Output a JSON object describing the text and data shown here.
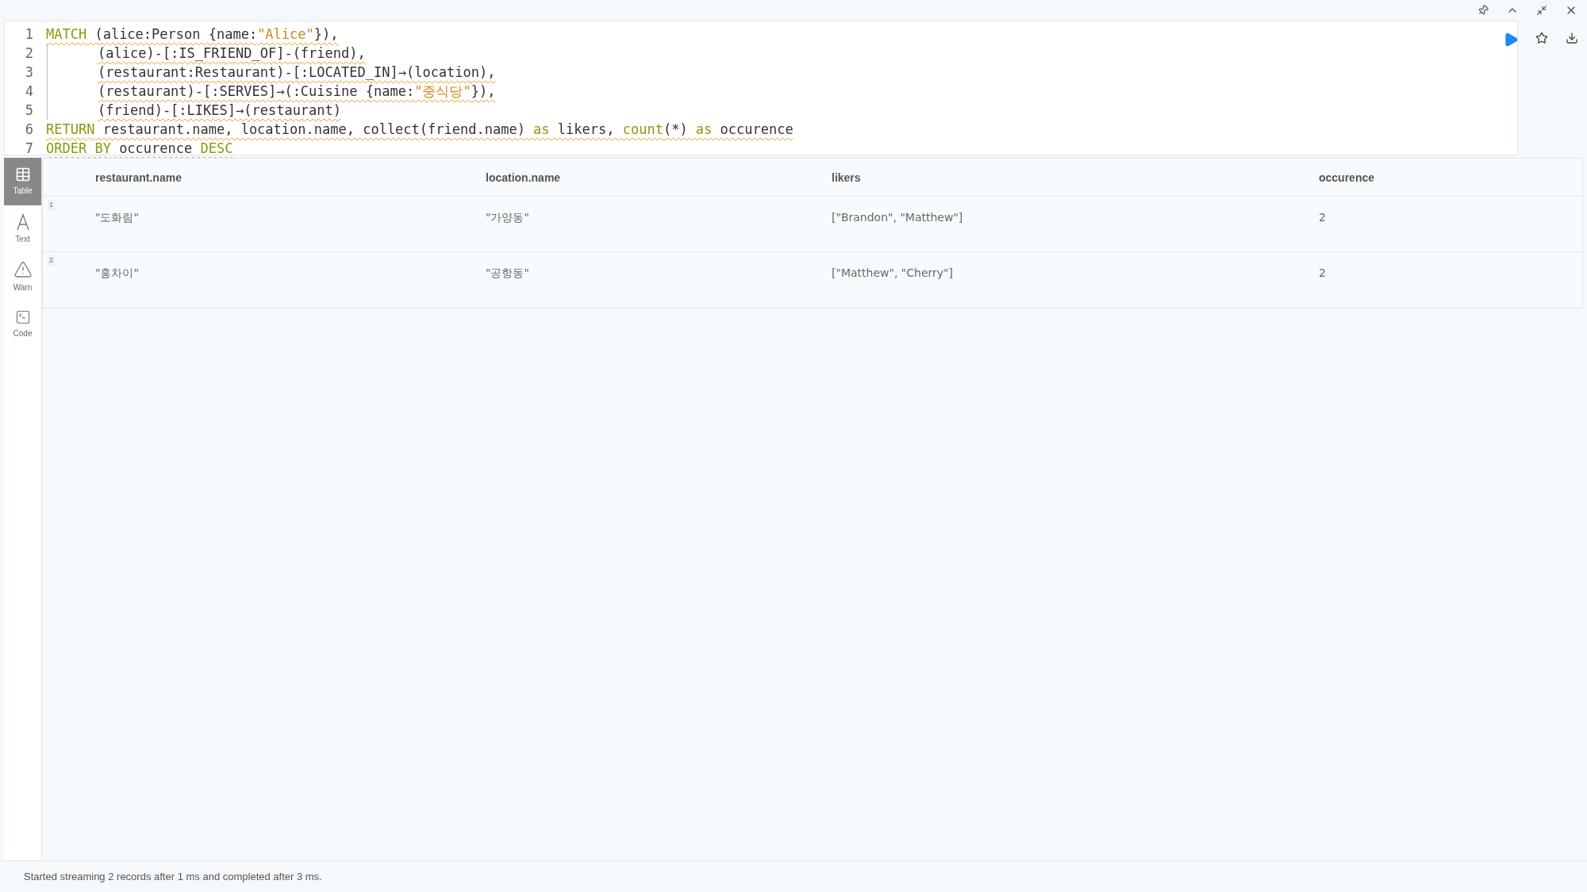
{
  "editor": {
    "lines": [
      {
        "number": "1",
        "indent": false,
        "warning": true,
        "tokens": [
          {
            "kind": "keyword",
            "text": "MATCH"
          },
          {
            "kind": "plain",
            "text": " (alice:Person {name:"
          },
          {
            "kind": "string",
            "text": "\"Alice\""
          },
          {
            "kind": "plain",
            "text": "}),"
          }
        ]
      },
      {
        "number": "2",
        "indent": true,
        "warning": true,
        "tokens": [
          {
            "kind": "plain",
            "text": "(alice)-[:IS_FRIEND_OF]-(friend),"
          }
        ]
      },
      {
        "number": "3",
        "indent": true,
        "warning": true,
        "tokens": [
          {
            "kind": "plain",
            "text": "(restaurant:Restaurant)-[:LOCATED_IN]→(location),"
          }
        ]
      },
      {
        "number": "4",
        "indent": true,
        "warning": true,
        "tokens": [
          {
            "kind": "plain",
            "text": "(restaurant)-[:SERVES]→(:Cuisine {name:"
          },
          {
            "kind": "string",
            "text": "\"중식당\""
          },
          {
            "kind": "plain",
            "text": "}),"
          }
        ]
      },
      {
        "number": "5",
        "indent": true,
        "warning": true,
        "tokens": [
          {
            "kind": "plain",
            "text": "(friend)-[:LIKES]→(restaurant)"
          }
        ]
      },
      {
        "number": "6",
        "indent": false,
        "warning": true,
        "tokens": [
          {
            "kind": "keyword",
            "text": "RETURN"
          },
          {
            "kind": "plain",
            "text": " restaurant.name, location.name, collect(friend.name) "
          },
          {
            "kind": "keyword",
            "text": "as"
          },
          {
            "kind": "plain",
            "text": " likers, "
          },
          {
            "kind": "keyword",
            "text": "count"
          },
          {
            "kind": "plain",
            "text": "(*) "
          },
          {
            "kind": "keyword",
            "text": "as"
          },
          {
            "kind": "plain",
            "text": " occurence"
          }
        ]
      },
      {
        "number": "7",
        "indent": false,
        "warning": true,
        "tokens": [
          {
            "kind": "keyword",
            "text": "ORDER BY"
          },
          {
            "kind": "plain",
            "text": " occurence "
          },
          {
            "kind": "keyword",
            "text": "DESC"
          }
        ]
      }
    ]
  },
  "view_tabs": [
    {
      "kind": "table",
      "label": "Table",
      "selected": true
    },
    {
      "kind": "text",
      "label": "Text",
      "selected": false
    },
    {
      "kind": "warn",
      "label": "Warn",
      "selected": false
    },
    {
      "kind": "code",
      "label": "Code",
      "selected": false
    }
  ],
  "table": {
    "columns": [
      "restaurant.name",
      "location.name",
      "likers",
      "occurence"
    ],
    "rows": [
      {
        "index": "1",
        "cells": [
          "\"도화림\"",
          "\"가양동\"",
          "[\"Brandon\", \"Matthew\"]",
          "2"
        ]
      },
      {
        "index": "2",
        "cells": [
          "\"홍차이\"",
          "\"공항동\"",
          "[\"Matthew\", \"Cherry\"]",
          "2"
        ]
      }
    ]
  },
  "status_bar": "Started streaming 2 records after 1 ms and completed after 3 ms."
}
